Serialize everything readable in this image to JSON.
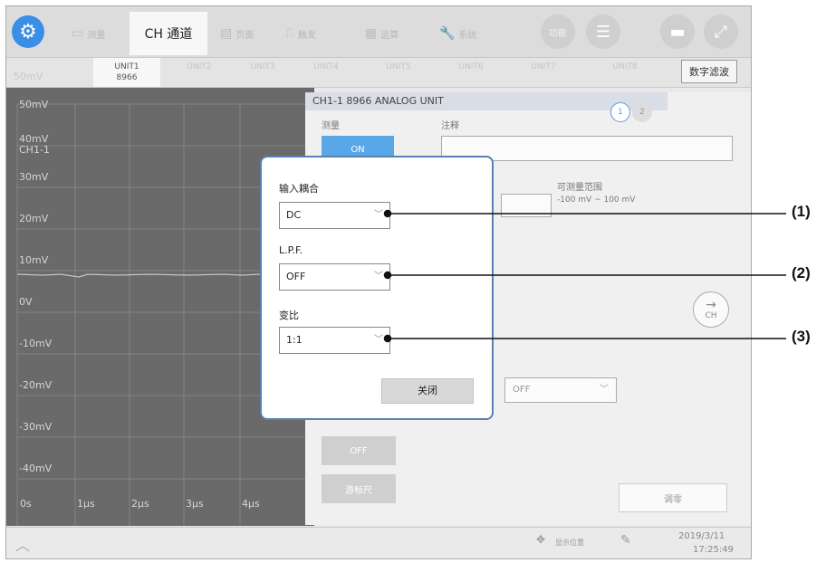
{
  "toolbar": {
    "tabs": [
      {
        "label": "测量",
        "active": false
      },
      {
        "label": "CH 通道",
        "active": true
      },
      {
        "label": "页面",
        "active": false
      },
      {
        "label": "触发",
        "active": false
      },
      {
        "label": "运算",
        "active": false
      },
      {
        "label": "系统",
        "active": false
      }
    ],
    "function_label": "功能"
  },
  "units": {
    "tabs": [
      {
        "name": "UNIT1",
        "model": "8966",
        "active": true
      },
      {
        "name": "UNIT2",
        "model": "",
        "active": false
      },
      {
        "name": "UNIT3",
        "model": "",
        "active": false
      },
      {
        "name": "UNIT4",
        "model": "",
        "active": false
      },
      {
        "name": "UNIT5",
        "model": "",
        "active": false
      },
      {
        "name": "UNIT6",
        "model": "",
        "active": false
      },
      {
        "name": "UNIT7",
        "model": "",
        "active": false
      },
      {
        "name": "UNIT8",
        "model": "",
        "active": false
      }
    ],
    "digital_filter_label": "数字滤波"
  },
  "waveform": {
    "top_label": "50mV",
    "y_labels": [
      "50mV",
      "40mV",
      "30mV",
      "20mV",
      "10mV",
      "0V",
      "-10mV",
      "-20mV",
      "-30mV",
      "-40mV"
    ],
    "channel_label": "CH1-1",
    "x_labels": [
      "0s",
      "1μs",
      "2μs",
      "3μs",
      "4μs"
    ]
  },
  "channel_panel": {
    "title": "CH1-1     8966 ANALOG UNIT",
    "measure_label": "测量",
    "measure_value": "ON",
    "comment_label": "注释",
    "range_label": "可测量范围",
    "range_value": "-100 mV ~ 100 mV",
    "page1": "1",
    "page2": "2",
    "next_ch_label": "CH",
    "filter_value": "OFF",
    "off_button": "OFF",
    "cursor_button": "游标尺",
    "zero_adjust_button": "调零"
  },
  "dialog": {
    "input_coupling_label": "输入耦合",
    "input_coupling_value": "DC",
    "lpf_label": "L.P.F.",
    "lpf_value": "OFF",
    "ratio_label": "变比",
    "ratio_value": "1:1",
    "close_button": "关闭"
  },
  "callouts": [
    "(1)",
    "(2)",
    "(3)"
  ],
  "statusbar": {
    "display_position_label": "显示位置",
    "date": "2019/3/11",
    "time": "17:25:49"
  }
}
